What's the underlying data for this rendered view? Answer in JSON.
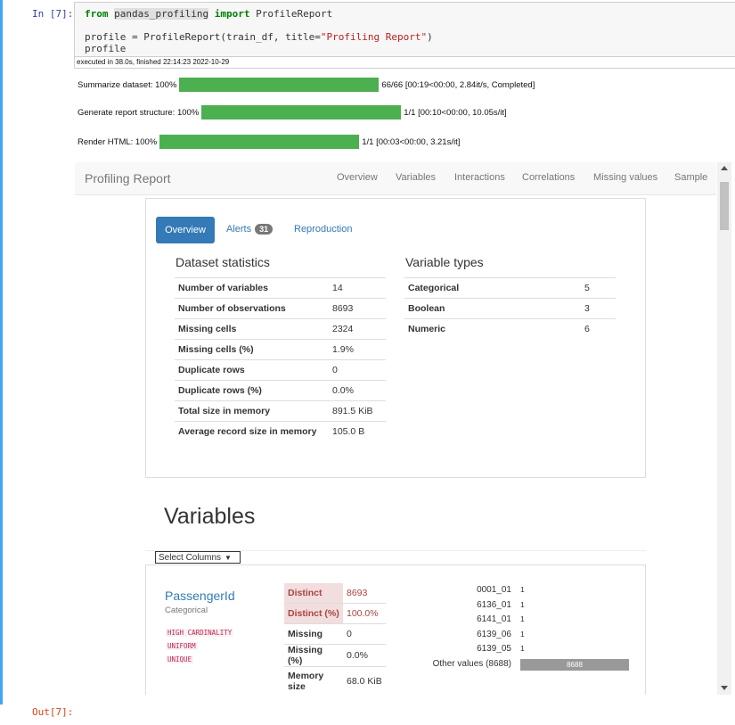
{
  "cell": {
    "in_prompt": "In [7]:",
    "out_prompt": "Out[7]:",
    "code": {
      "kw_from": "from",
      "module": "pandas_profiling",
      "kw_import": "import",
      "cls": "ProfileReport",
      "line2_pre": "profile = ProfileReport(train_df, title=",
      "line2_str": "\"Profiling Report\"",
      "line2_post": ")",
      "line3": "profile"
    },
    "exec_info": "executed in 38.0s, finished 22:14:23 2022-10-29"
  },
  "progress": [
    {
      "label": "Summarize dataset: 100%",
      "status": "66/66 [00:19<00:00, 2.84it/s, Completed]",
      "fraction": 1.0
    },
    {
      "label": "Generate report structure: 100%",
      "status": "1/1 [00:10<00:00, 10.05s/it]",
      "fraction": 1.0
    },
    {
      "label": "Render HTML: 100%",
      "status": "1/1 [00:03<00:00, 3.21s/it]",
      "fraction": 1.0
    }
  ],
  "report": {
    "brand": "Profiling Report",
    "nav": [
      "Overview",
      "Variables",
      "Interactions",
      "Correlations",
      "Missing values",
      "Sample"
    ],
    "tabs": {
      "overview": "Overview",
      "alerts": "Alerts",
      "alerts_count": "31",
      "reproduction": "Reproduction"
    },
    "dataset_statistics": {
      "title": "Dataset statistics",
      "rows": [
        {
          "k": "Number of variables",
          "v": "14"
        },
        {
          "k": "Number of observations",
          "v": "8693"
        },
        {
          "k": "Missing cells",
          "v": "2324"
        },
        {
          "k": "Missing cells (%)",
          "v": "1.9%"
        },
        {
          "k": "Duplicate rows",
          "v": "0"
        },
        {
          "k": "Duplicate rows (%)",
          "v": "0.0%"
        },
        {
          "k": "Total size in memory",
          "v": "891.5 KiB"
        },
        {
          "k": "Average record size in memory",
          "v": "105.0 B"
        }
      ]
    },
    "variable_types": {
      "title": "Variable types",
      "rows": [
        {
          "k": "Categorical",
          "v": "5"
        },
        {
          "k": "Boolean",
          "v": "3"
        },
        {
          "k": "Numeric",
          "v": "6"
        }
      ]
    },
    "variables_title": "Variables",
    "select_columns": "Select Columns",
    "variable": {
      "name": "PassengerId",
      "type": "Categorical",
      "alerts": [
        "HIGH CARDINALITY",
        "UNIFORM",
        "UNIQUE"
      ],
      "stats": [
        {
          "k": "Distinct",
          "v": "8693"
        },
        {
          "k": "Distinct (%)",
          "v": "100.0%"
        },
        {
          "k": "Missing",
          "v": "0"
        },
        {
          "k": "Missing (%)",
          "v": "0.0%"
        },
        {
          "k": "Memory size",
          "v": "68.0 KiB"
        }
      ],
      "freq": [
        {
          "label": "0001_01",
          "count": "1"
        },
        {
          "label": "6136_01",
          "count": "1"
        },
        {
          "label": "6141_01",
          "count": "1"
        },
        {
          "label": "6139_06",
          "count": "1"
        },
        {
          "label": "6139_05",
          "count": "1"
        }
      ],
      "other": {
        "label": "Other values (8688)",
        "count": "8688"
      }
    }
  }
}
